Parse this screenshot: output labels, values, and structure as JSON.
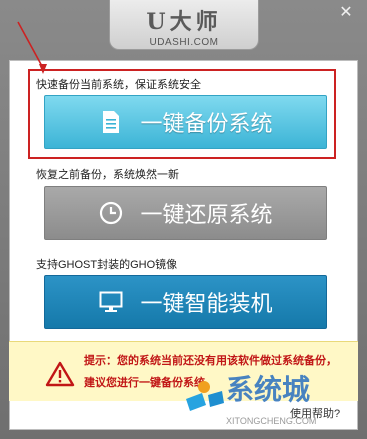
{
  "window": {
    "close_glyph": "✕"
  },
  "logo": {
    "text": "U大师",
    "url": "UDASHI.COM"
  },
  "sections": {
    "backup": {
      "label": "快速备份当前系统，保证系统安全",
      "button_label": "一键备份系统",
      "icon": "document-icon",
      "color": "#4fc1e0"
    },
    "restore": {
      "label": "恢复之前备份，系统焕然一新",
      "button_label": "一键还原系统",
      "icon": "clock-icon",
      "color": "#9a9a9a"
    },
    "install": {
      "label": "支持GHOST封装的GHO镜像",
      "button_label": "一键智能装机",
      "icon": "monitor-icon",
      "color": "#1d86b8"
    }
  },
  "tip": {
    "prefix": "提示：",
    "text": "您的系统当前还没有用该软件做过系统备份，建议您进行一键备份系统",
    "icon": "warning-icon"
  },
  "help_link": "使用帮助?",
  "watermark": {
    "text": "系统城",
    "url": "XITONGCHENG.COM"
  },
  "colors": {
    "highlight_border": "#cc2222",
    "tip_background": "#fff8c6",
    "tip_text": "#c11616"
  }
}
